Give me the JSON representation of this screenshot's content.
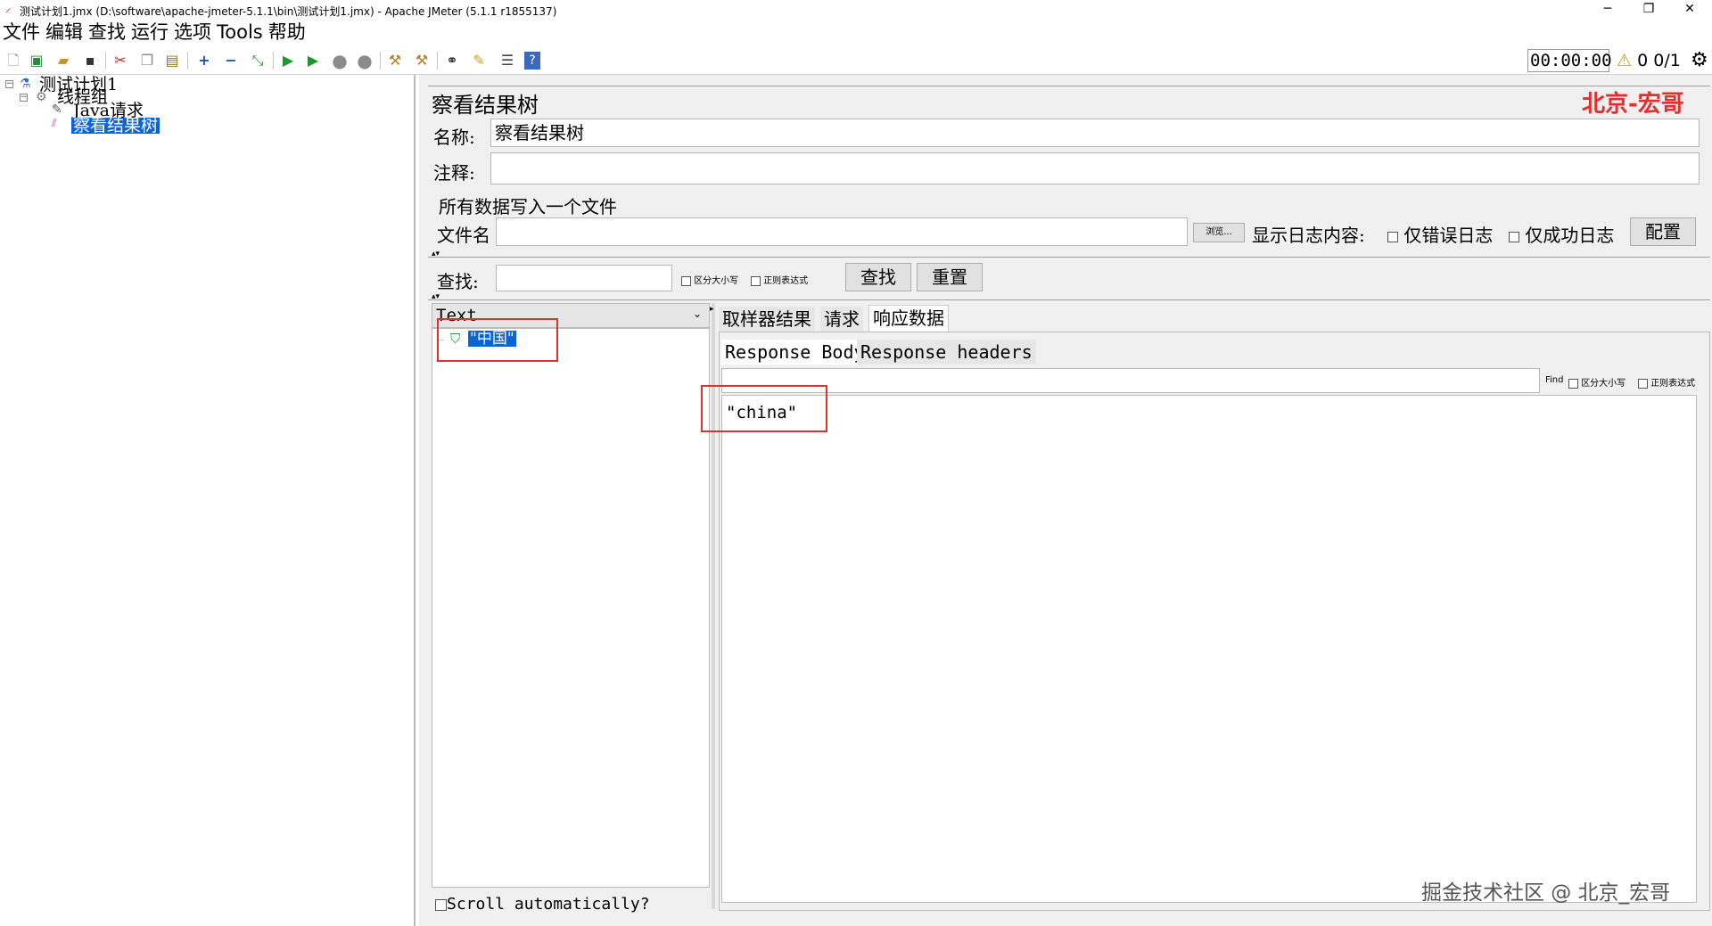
{
  "window": {
    "title": "测试计划1.jmx (D:\\software\\apache-jmeter-5.1.1\\bin\\测试计划1.jmx) - Apache JMeter (5.1.1 r1855137)",
    "minimize": "─",
    "restore": "❐",
    "close": "✕"
  },
  "menu": [
    "文件",
    "编辑",
    "查找",
    "运行",
    "选项",
    "Tools",
    "帮助"
  ],
  "toolbar": {
    "icons": [
      "new-icon",
      "templates-icon",
      "open-icon",
      "save-icon",
      "cut-icon",
      "copy-icon",
      "paste-icon",
      "expand-icon",
      "collapse-icon",
      "toggle-icon",
      "start-icon",
      "start-no-pause-icon",
      "stop-icon",
      "shutdown-icon",
      "clear-icon",
      "clear-all-icon",
      "search-icon",
      "reset-search-icon",
      "function-helper-icon",
      "help-icon"
    ],
    "timer": "00:00:00",
    "warning_count": "0",
    "threads": "0/1"
  },
  "tree": {
    "plan": "测试计划1",
    "thread_group": "线程组",
    "sampler": "Java请求",
    "listener": "察看结果树"
  },
  "listener_panel": {
    "heading": "察看结果树",
    "watermark": "北京-宏哥",
    "name_label": "名称:",
    "name_value": "察看结果树",
    "comment_label": "注释:",
    "comment_value": "",
    "file_section": "所有数据写入一个文件",
    "filename_label": "文件名",
    "filename_value": "",
    "browse_button": "浏览...",
    "log_label": "显示日志内容:",
    "errors_only": "仅错误日志",
    "success_only": "仅成功日志",
    "configure_button": "配置",
    "search_label": "查找:",
    "search_value": "",
    "case_sensitive": "区分大小写",
    "regex": "正则表达式",
    "find_button": "查找",
    "reset_button": "重置"
  },
  "results": {
    "renderer": "Text",
    "sample_label": "\"中国\"",
    "scroll_auto": "Scroll automatically?",
    "tabs": [
      "取样器结果",
      "请求",
      "响应数据"
    ],
    "active_tab": "响应数据",
    "subtabs": [
      "Response Body",
      "Response headers"
    ],
    "find_label": "Find",
    "find_case": "区分大小写",
    "find_regex": "正则表达式",
    "response_body": "\"china\""
  },
  "footer_watermark": "掘金技术社区 @ 北京_宏哥",
  "colors": {
    "selection": "#0a64d6",
    "watermark_red": "#e03030",
    "annotation_box": "#e03030",
    "success_green": "#1a9a2a"
  }
}
